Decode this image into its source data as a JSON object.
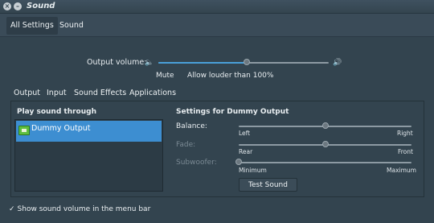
{
  "window": {
    "title": "Sound"
  },
  "nav": {
    "tabs": [
      {
        "label": "All Settings"
      },
      {
        "label": "Sound"
      }
    ]
  },
  "output_volume": {
    "label": "Output volume:",
    "level": 0.52,
    "mute_label": "Mute",
    "allow_louder_label": "Allow louder than 100%"
  },
  "subtabs": [
    {
      "label": "Output"
    },
    {
      "label": "Input"
    },
    {
      "label": "Sound Effects"
    },
    {
      "label": "Applications"
    }
  ],
  "play_through": {
    "heading": "Play sound through",
    "devices": [
      {
        "name": "Dummy Output",
        "icon": "audio-card-icon"
      }
    ]
  },
  "device_settings": {
    "heading": "Settings for Dummy Output",
    "balance": {
      "label": "Balance:",
      "left": "Left",
      "right": "Right",
      "value": 0.5
    },
    "fade": {
      "label": "Fade:",
      "left": "Rear",
      "right": "Front",
      "value": 0.5
    },
    "subwoofer": {
      "label": "Subwoofer:",
      "left": "Minimum",
      "right": "Maximum",
      "value": 0.0
    },
    "test_button": "Test Sound"
  },
  "footer": {
    "show_volume_label": "Show sound volume in the menu bar",
    "checked": true
  },
  "colors": {
    "accent": "#3d8ed1",
    "window_bg": "#33444f"
  }
}
